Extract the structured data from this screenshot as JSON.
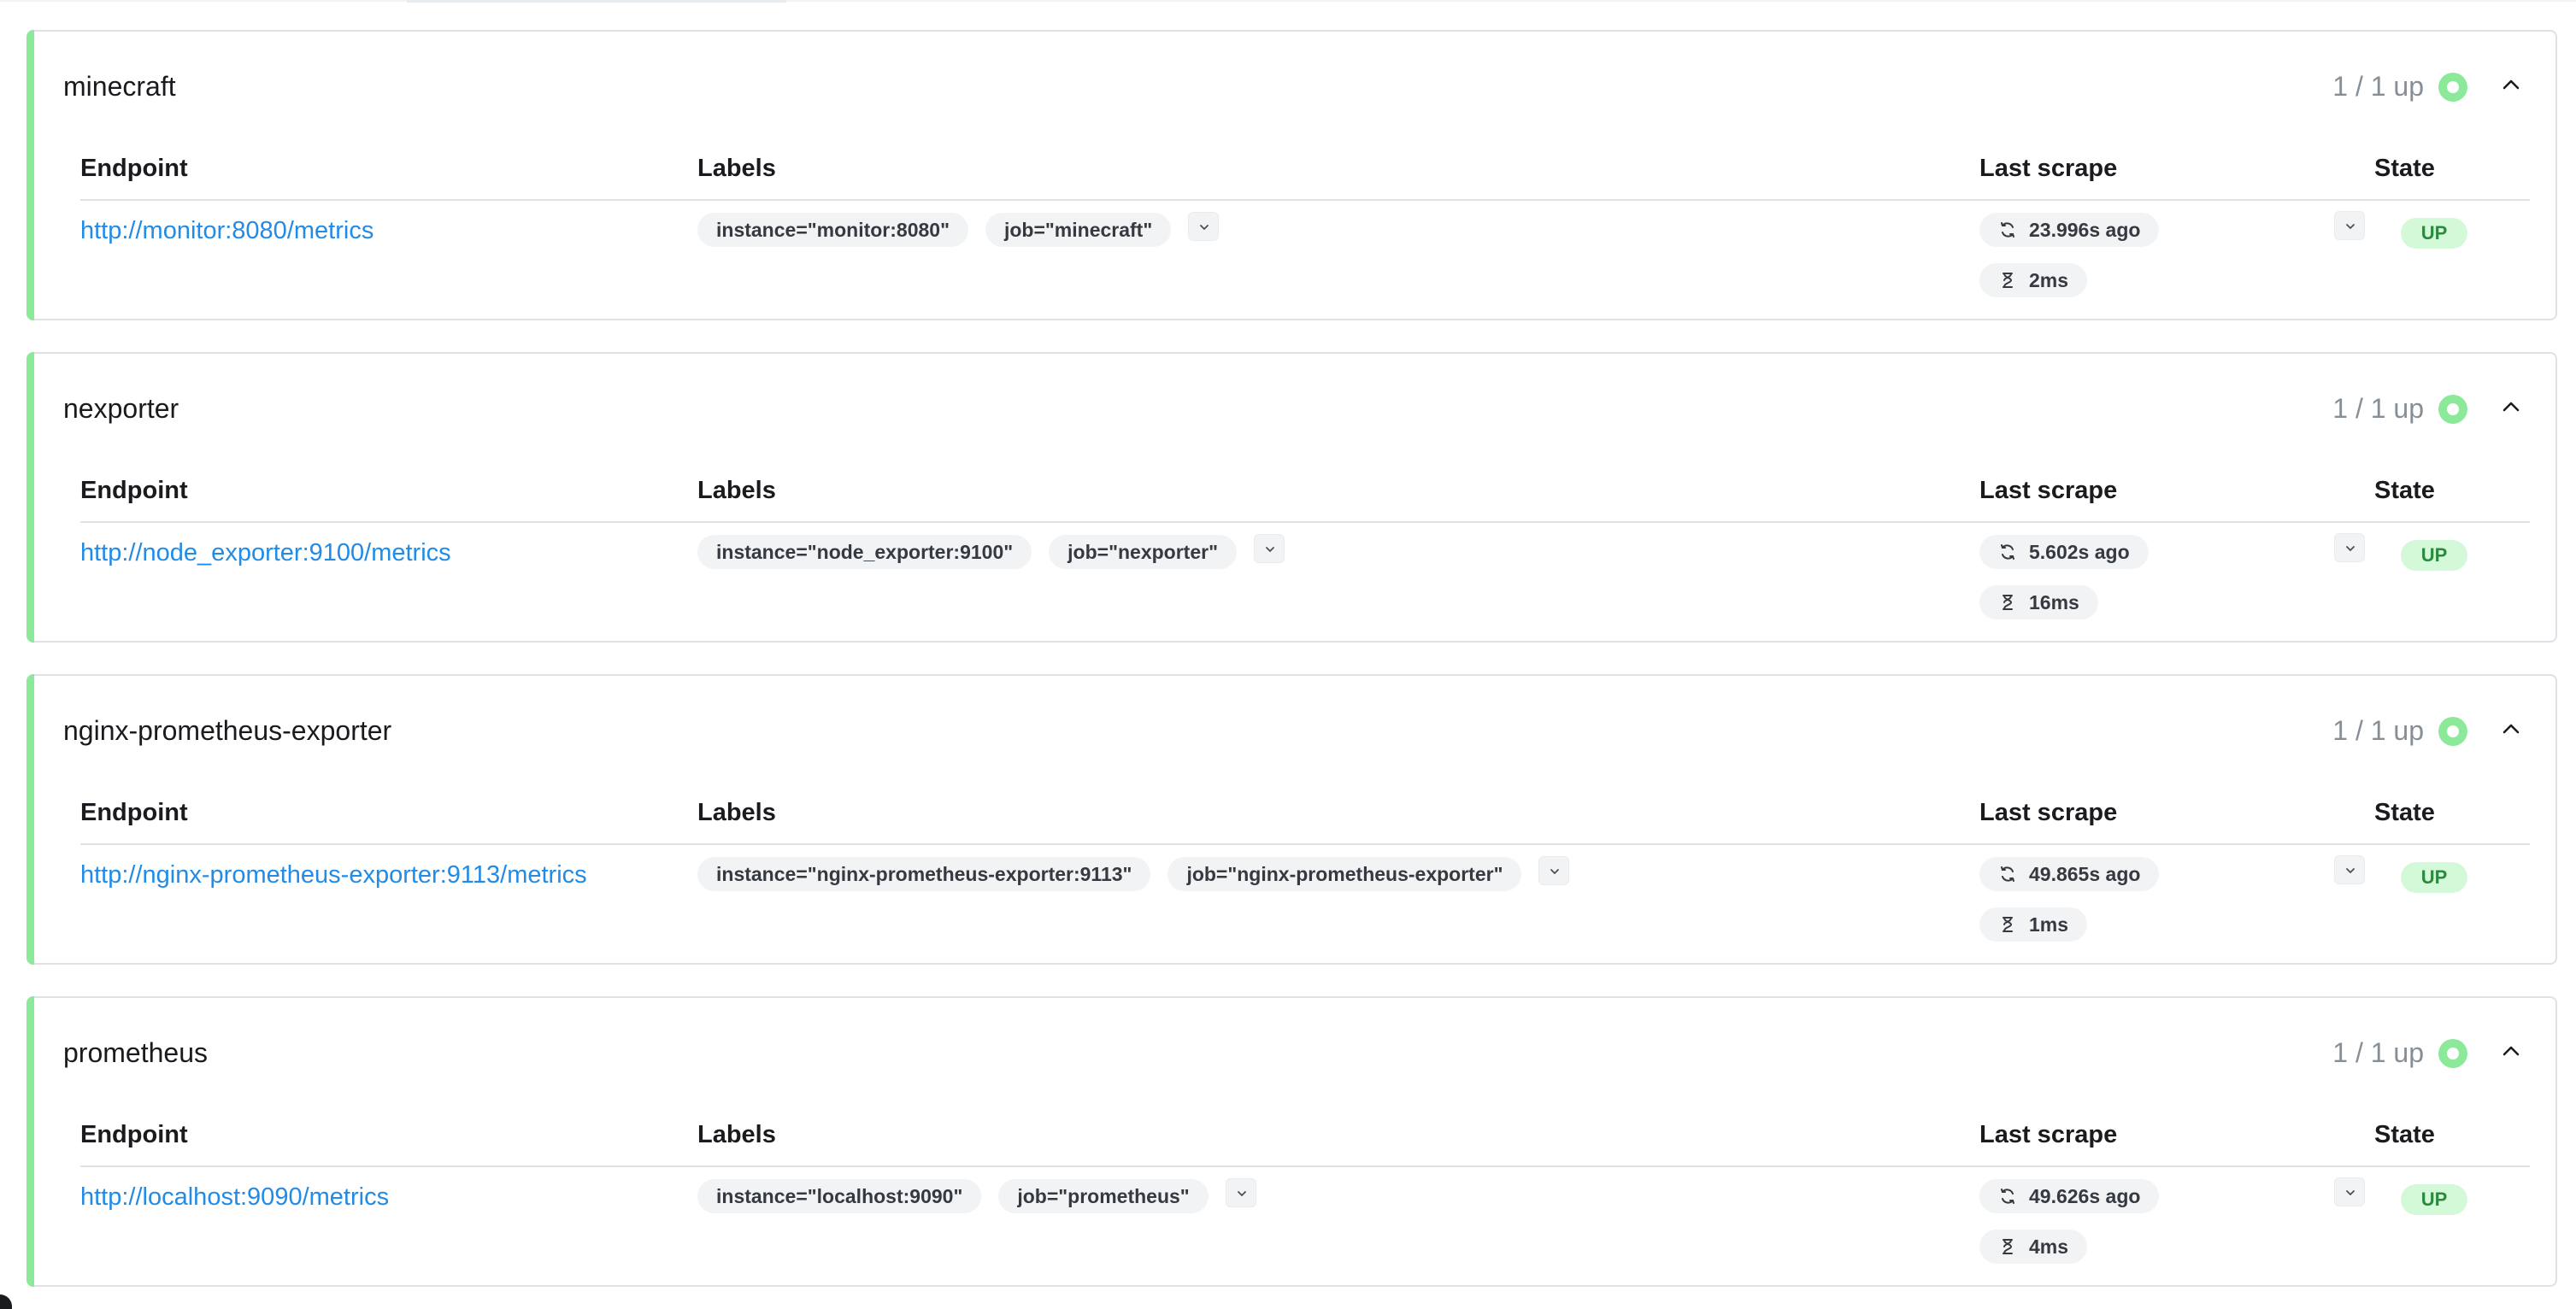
{
  "pools": [
    {
      "name": "minecraft",
      "health": "1 / 1 up",
      "columns": {
        "endpoint": "Endpoint",
        "labels": "Labels",
        "last_scrape": "Last scrape",
        "state": "State"
      },
      "target": {
        "endpoint": "http://monitor:8080/metrics",
        "labels": [
          "instance=\"monitor:8080\"",
          "job=\"minecraft\""
        ],
        "last_scrape": "23.996s ago",
        "duration": "2ms",
        "state": "UP"
      }
    },
    {
      "name": "nexporter",
      "health": "1 / 1 up",
      "columns": {
        "endpoint": "Endpoint",
        "labels": "Labels",
        "last_scrape": "Last scrape",
        "state": "State"
      },
      "target": {
        "endpoint": "http://node_exporter:9100/metrics",
        "labels": [
          "instance=\"node_exporter:9100\"",
          "job=\"nexporter\""
        ],
        "last_scrape": "5.602s ago",
        "duration": "16ms",
        "state": "UP"
      }
    },
    {
      "name": "nginx-prometheus-exporter",
      "health": "1 / 1 up",
      "columns": {
        "endpoint": "Endpoint",
        "labels": "Labels",
        "last_scrape": "Last scrape",
        "state": "State"
      },
      "target": {
        "endpoint": "http://nginx-prometheus-exporter:9113/metrics",
        "labels": [
          "instance=\"nginx-prometheus-exporter:9113\"",
          "job=\"nginx-prometheus-exporter\""
        ],
        "last_scrape": "49.865s ago",
        "duration": "1ms",
        "state": "UP"
      }
    },
    {
      "name": "prometheus",
      "health": "1 / 1 up",
      "columns": {
        "endpoint": "Endpoint",
        "labels": "Labels",
        "last_scrape": "Last scrape",
        "state": "State"
      },
      "target": {
        "endpoint": "http://localhost:9090/metrics",
        "labels": [
          "instance=\"localhost:9090\"",
          "job=\"prometheus\""
        ],
        "last_scrape": "49.626s ago",
        "duration": "4ms",
        "state": "UP"
      }
    }
  ],
  "icons": {
    "health": "circle-dot-icon",
    "collapse": "chevron-up-icon",
    "expand_labels": "chevron-down-icon",
    "last_scrape": "refresh-icon",
    "duration": "hourglass-icon"
  },
  "colors": {
    "accent_up": "#8ce99a",
    "link": "#228be6",
    "badge_up_bg": "#d3f9d8",
    "badge_up_text": "#2b8a3e"
  }
}
